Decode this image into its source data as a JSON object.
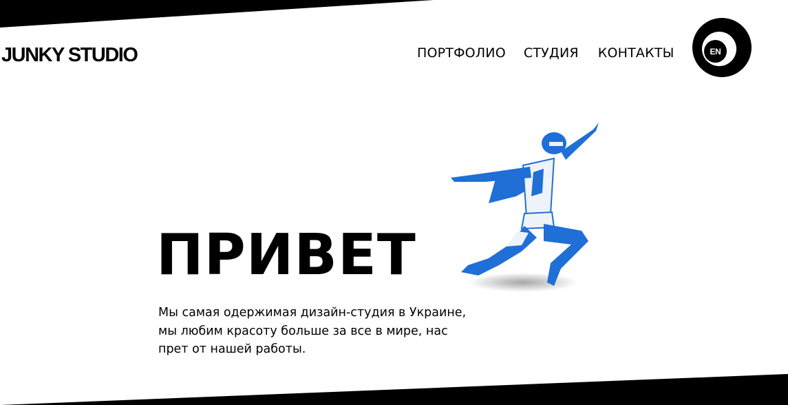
{
  "brand": {
    "logo": "JUNKY STUDIO"
  },
  "nav": {
    "items": [
      {
        "label": "ПОРТФОЛИО"
      },
      {
        "label": "СТУДИЯ"
      },
      {
        "label": "КОНТАКТЫ"
      }
    ]
  },
  "language": {
    "label": "EN"
  },
  "hero": {
    "title": "ПРИВЕТ",
    "lines": [
      "Мы самая одержимая дизайн-студия в Украине,",
      "мы любим красоту больше за все в мире, нас",
      "прет от нашей работы."
    ],
    "image": "flying-superhero"
  },
  "colors": {
    "background": "#ffffff",
    "text": "#000000",
    "hero_blue": "#1f6fd6",
    "hero_white": "#eef3fa"
  }
}
